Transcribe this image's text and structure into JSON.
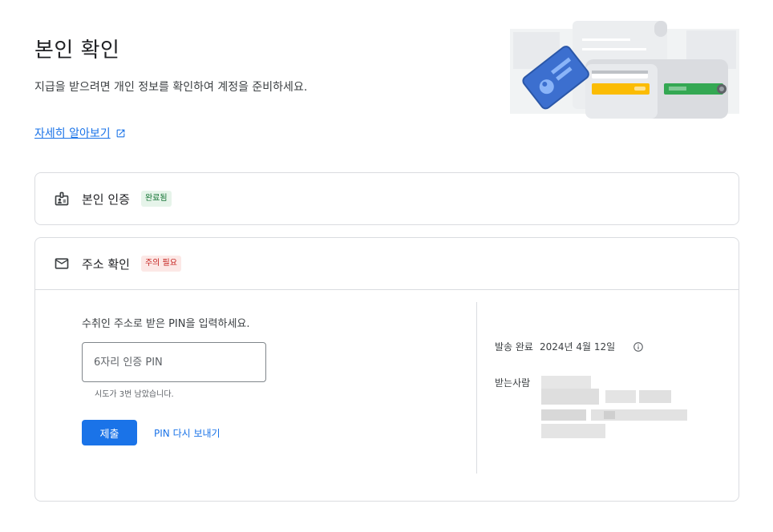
{
  "header": {
    "title": "본인 확인",
    "description": "지급을 받으려면 개인 정보를 확인하여 계정을 준비하세요.",
    "learn_more": "자세히 알아보기"
  },
  "identity_section": {
    "title": "본인 인증",
    "badge": "완료됨",
    "icon": "id-badge-icon"
  },
  "address_section": {
    "title": "주소 확인",
    "badge": "주의 필요",
    "icon": "mail-icon",
    "instruction": "수취인 주소로 받은 PIN을 입력하세요.",
    "pin_placeholder": "6자리 인증 PIN",
    "attempts_text": "시도가 3번 남았습니다.",
    "submit_label": "제출",
    "resend_label": "PIN 다시 보내기",
    "sent_label": "발송 완료",
    "sent_date": "2024년 4월 12일",
    "recipient_label": "받는사람"
  },
  "colors": {
    "accent": "#1a73e8",
    "done_bg": "#e6f4ea",
    "done_text": "#137333",
    "warn_bg": "#fce8e6",
    "warn_text": "#c5221f"
  }
}
